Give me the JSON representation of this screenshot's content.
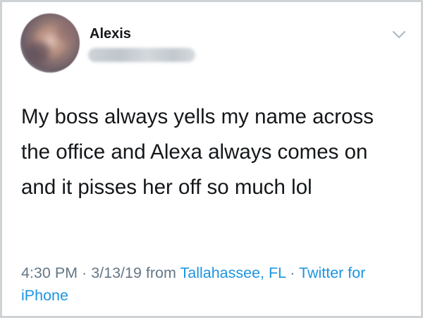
{
  "tweet": {
    "author_name": "Alexis",
    "text": "My boss always yells my name across the office and Alexa always comes on and it pisses her off so much lol",
    "time": "4:30 PM",
    "separator": " · ",
    "date": "3/13/19",
    "from_label": " from ",
    "location": "Tallahassee, FL",
    "source": "Twitter for iPhone"
  },
  "icons": {
    "menu": "chevron-down-icon"
  },
  "colors": {
    "text": "#14171a",
    "secondary": "#657786",
    "link": "#1b95e0"
  }
}
